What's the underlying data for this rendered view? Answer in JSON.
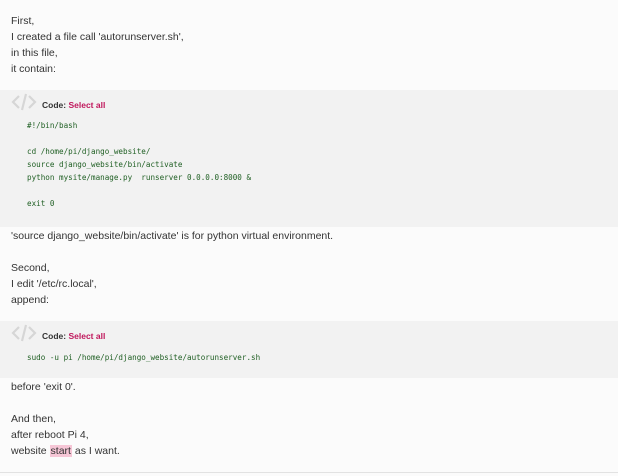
{
  "post": {
    "p1": [
      "First,",
      "I created a file call 'autorunserver.sh',",
      "in this file,",
      "it contain:"
    ],
    "code1": {
      "header_label": "Code:",
      "select_all": "Select all",
      "lines": [
        "#!/bin/bash",
        "",
        "cd /home/pi/django_website/",
        "source django_website/bin/activate",
        "python mysite/manage.py  runserver 0.0.0.0:8000 &",
        "",
        "exit 0"
      ]
    },
    "p2": "'source django_website/bin/activate' is for python virtual environment.",
    "p3": [
      "Second,",
      "I edit '/etc/rc.local',",
      "append:"
    ],
    "code2": {
      "header_label": "Code:",
      "select_all": "Select all",
      "lines": [
        "sudo -u pi /home/pi/django_website/autorunserver.sh"
      ]
    },
    "p4": "before 'exit 0'.",
    "p5": [
      "And then,",
      "after reboot Pi 4,"
    ],
    "p6": {
      "before": "website ",
      "highlight": "start",
      "after": " as I want."
    }
  },
  "colors": {
    "select_all": "#c0175c",
    "code_text": "#1f5f23",
    "code_bg": "#f2f2f2",
    "highlight": "#f6c6d6"
  },
  "icons": {
    "code_block": "code-brackets-icon"
  }
}
